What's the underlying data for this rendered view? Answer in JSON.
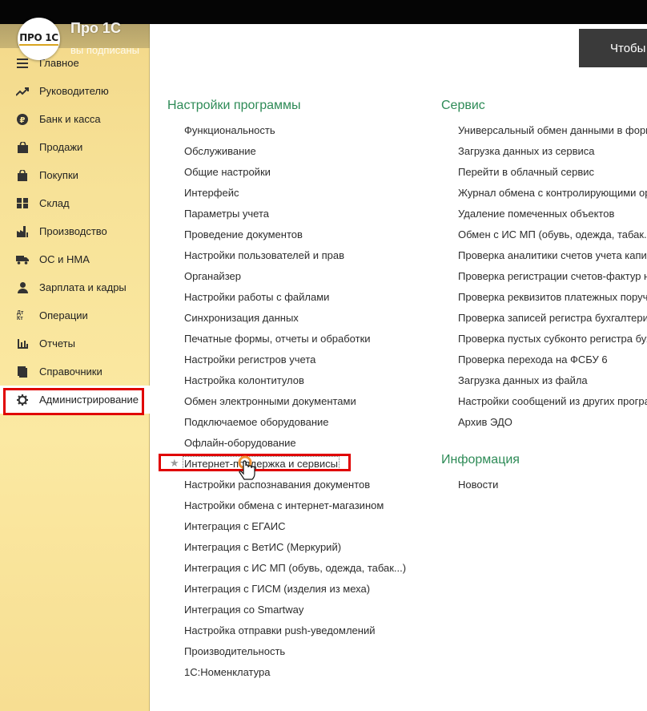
{
  "channel": {
    "logo_text": "ПРО 1С",
    "name": "Про 1С",
    "subtitle": "вы подписаны"
  },
  "sidebar": {
    "items": [
      {
        "label": "Главное",
        "icon": "menu-lines-icon"
      },
      {
        "label": "Руководителю",
        "icon": "trend-up-icon"
      },
      {
        "label": "Банк и касса",
        "icon": "ruble-coin-icon"
      },
      {
        "label": "Продажи",
        "icon": "shopping-bag-icon"
      },
      {
        "label": "Покупки",
        "icon": "cart-icon"
      },
      {
        "label": "Склад",
        "icon": "warehouse-icon"
      },
      {
        "label": "Производство",
        "icon": "factory-icon"
      },
      {
        "label": "ОС и НМА",
        "icon": "truck-icon"
      },
      {
        "label": "Зарплата и кадры",
        "icon": "person-icon"
      },
      {
        "label": "Операции",
        "icon": "debit-credit-icon",
        "icon_text": "Дт Кт"
      },
      {
        "label": "Отчеты",
        "icon": "bar-chart-icon"
      },
      {
        "label": "Справочники",
        "icon": "book-icon"
      },
      {
        "label": "Администрирование",
        "icon": "gear-icon",
        "active": true
      }
    ]
  },
  "header": {
    "button_label": "Чтобы"
  },
  "settings": {
    "title": "Настройки программы",
    "links": [
      "Функциональность",
      "Обслуживание",
      "Общие настройки",
      "Интерфейс",
      "Параметры учета",
      "Проведение документов",
      "Настройки пользователей и прав",
      "Органайзер",
      "Настройки работы с файлами",
      "Синхронизация данных",
      "Печатные формы, отчеты и обработки",
      "Настройки регистров учета",
      "Настройка колонтитулов",
      "Обмен электронными документами",
      "Подключаемое оборудование",
      "Офлайн-оборудование",
      "Интернет-поддержка и сервисы",
      "Настройки распознавания документов",
      "Настройки обмена с интернет-магазином",
      "Интеграция с ЕГАИС",
      "Интеграция с ВетИС (Меркурий)",
      "Интеграция с ИС МП (обувь, одежда, табак...)",
      "Интеграция с ГИСМ (изделия из меха)",
      "Интеграция со Smartway",
      "Настройка отправки push-уведомлений",
      "Производительность",
      "1С:Номенклатура"
    ]
  },
  "service": {
    "title": "Сервис",
    "links": [
      "Универсальный обмен данными в формате",
      "Загрузка данных из сервиса",
      "Перейти в облачный сервис",
      "Журнал обмена с контролирующими органами",
      "Удаление помеченных объектов",
      "Обмен с ИС МП (обувь, одежда, табак...)",
      "Проверка аналитики счетов учета капитальных",
      "Проверка регистрации счетов-фактур на аванс",
      "Проверка реквизитов платежных поручений",
      "Проверка записей регистра бухгалтерии",
      "Проверка пустых субконто регистра бухгалтерии",
      "Проверка перехода на ФСБУ 6",
      "Загрузка данных из файла",
      "Настройки сообщений из других программ",
      "Архив ЭДО"
    ]
  },
  "info": {
    "title": "Информация",
    "links": [
      "Новости"
    ]
  },
  "colors": {
    "section_title": "#2e8b57",
    "sidebar_bg": "#f7e298",
    "highlight": "#e00000"
  }
}
